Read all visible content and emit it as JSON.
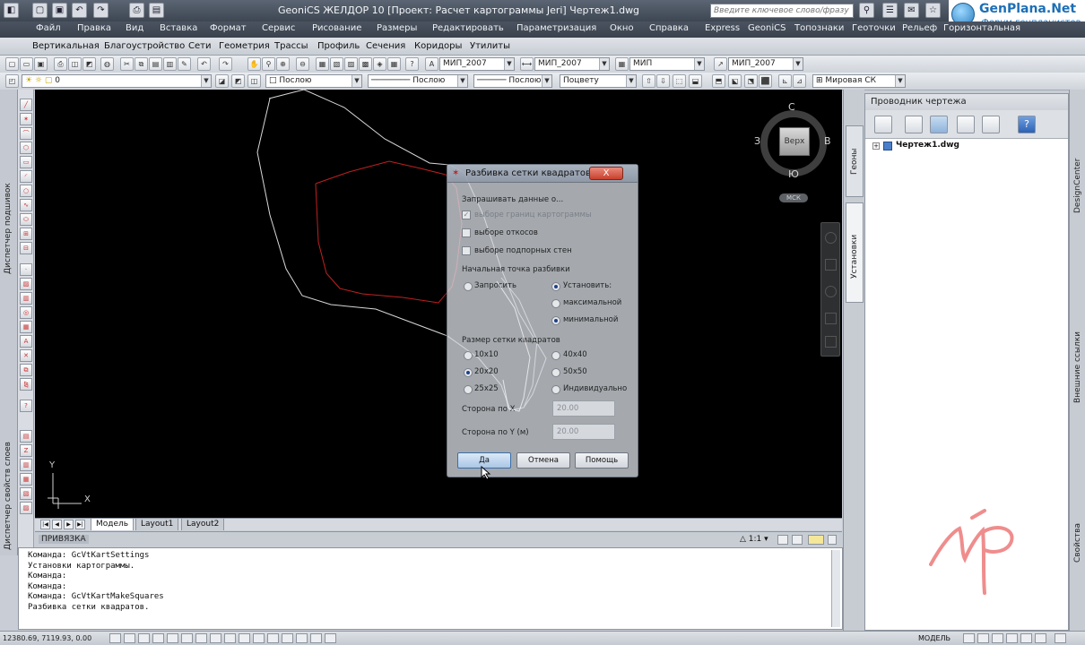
{
  "window": {
    "title": "GeoniCS ЖЕЛДОР 10 [Проект: Расчет картограммы Jeri]    Чертеж1.dwg",
    "search_placeholder": "Введите ключевое слово/фразу"
  },
  "logo": {
    "name": "GenPlana.Net",
    "subtitle": "Форум генпланистов"
  },
  "menu_top": [
    "Файл",
    "Правка",
    "Вид",
    "Вставка",
    "Формат",
    "Сервис",
    "Рисование",
    "Размеры",
    "Редактировать",
    "Параметризация",
    "Окно",
    "Справка",
    "Express",
    "GeoniCS",
    "Топознаки",
    "Геоточки",
    "Рельеф",
    "Горизонтальная"
  ],
  "menu_second": [
    "Вертикальная",
    "Благоустройство",
    "Сети",
    "Геометрия",
    "Трассы",
    "Профиль",
    "Сечения",
    "Коридоры",
    "Утилиты"
  ],
  "toolbar1": {
    "style1": "МИП_2007",
    "style2": "МИП_2007",
    "style3": "МИП",
    "style4": "МИП_2007"
  },
  "toolbar2": {
    "layer": "0",
    "color": "Послою",
    "linetype": "Послою",
    "lineweight": "Послою",
    "plotstyle": "Поцвету",
    "ucs": "Мировая СК"
  },
  "left_panels": {
    "top": "Диспетчер подшивок",
    "bottom": "Диспетчер свойств слоев"
  },
  "viewcube": {
    "north": "С",
    "south": "Ю",
    "west": "З",
    "east": "В",
    "face": "Верх",
    "ucs": "МСК"
  },
  "axes": {
    "y": "Y",
    "x": "X"
  },
  "tabs": [
    "Модель",
    "Layout1",
    "Layout2"
  ],
  "command": {
    "header": "ПРИВЯЗКА",
    "lines": [
      "Команда: GcVtKartSettings",
      "Установки картограммы.",
      "Команда:",
      "Команда:",
      "Команда: GcVtKartMakeSquares",
      "Разбивка сетки квадратов."
    ]
  },
  "status": {
    "coords": "12380.69, 7119.93, 0.00",
    "scale": "1:1",
    "space": "МОДЕЛЬ"
  },
  "right_panel": {
    "title": "Проводник чертежа",
    "tree_item": "Чертеж1.dwg",
    "side_tabs": [
      "Геоны",
      "Установки"
    ],
    "far_tabs": [
      "DesignCenter",
      "Внешние ссылки",
      "Свойства"
    ]
  },
  "dialog": {
    "title": "Разбивка сетки квадратов",
    "close": "X",
    "section_ask": "Запрашивать данные о...",
    "cb_borders": "выборе границ картограммы",
    "cb_slopes": "выборе откосов",
    "cb_walls": "выборе подпорных стен",
    "section_start": "Начальная точка разбивки",
    "rb_ask": "Запросить",
    "rb_set": "Установить:",
    "rb_max": "максимальной",
    "rb_min": "минимальной",
    "section_size": "Размер сетки квадратов",
    "sizes": [
      "10x10",
      "20x20",
      "25x25",
      "40x40",
      "50x50",
      "Индивидуально"
    ],
    "side_x_label": "Сторона по X",
    "side_x_value": "20.00",
    "side_y_label": "Сторона по Y (м)",
    "side_y_value": "20.00",
    "btn_ok": "Да",
    "btn_cancel": "Отмена",
    "btn_help": "Помощь"
  }
}
